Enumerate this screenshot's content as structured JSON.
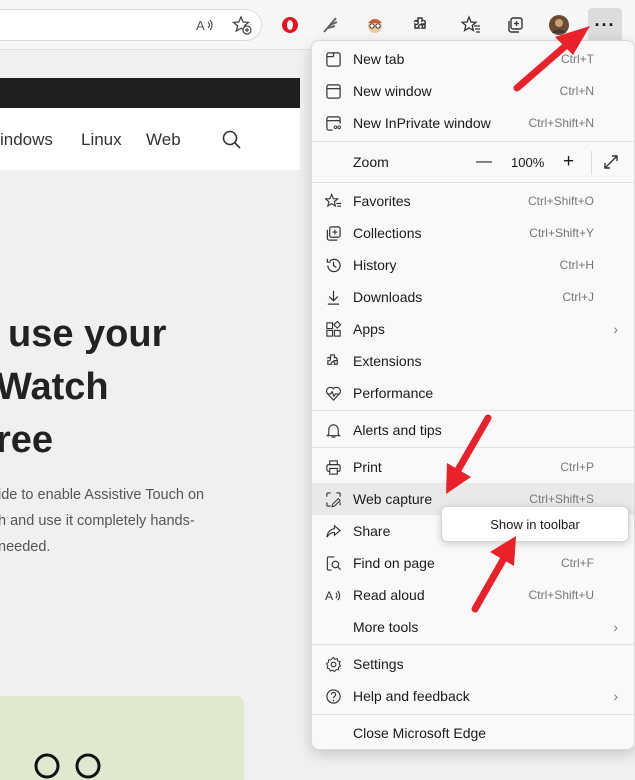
{
  "browser": {
    "more_button_label": "···",
    "toolbar_icons": [
      "read-aloud-icon",
      "add-favorite-icon",
      "opera-extension-icon",
      "feather-extension-icon",
      "face-extension-icon",
      "extensions-icon",
      "favorites-icon",
      "collections-icon",
      "profile-avatar-icon",
      "more-icon"
    ]
  },
  "page": {
    "nav": [
      "indows",
      "Linux",
      "Web"
    ],
    "headline": [
      "use your",
      "Watch",
      "ree"
    ],
    "body": [
      "ide to enable Assistive Touch on",
      "h and use it completely hands-",
      "needed."
    ]
  },
  "menu": {
    "items": [
      {
        "label": "New tab",
        "shortcut": "Ctrl+T",
        "icon": "new-tab-icon"
      },
      {
        "label": "New window",
        "shortcut": "Ctrl+N",
        "icon": "new-window-icon"
      },
      {
        "label": "New InPrivate window",
        "shortcut": "Ctrl+Shift+N",
        "icon": "inprivate-icon"
      },
      {
        "label": "Zoom",
        "icon": "zoom-icon"
      },
      {
        "label": "Favorites",
        "shortcut": "Ctrl+Shift+O",
        "icon": "favorites-icon"
      },
      {
        "label": "Collections",
        "shortcut": "Ctrl+Shift+Y",
        "icon": "collections-icon"
      },
      {
        "label": "History",
        "shortcut": "Ctrl+H",
        "icon": "history-icon"
      },
      {
        "label": "Downloads",
        "shortcut": "Ctrl+J",
        "icon": "download-icon"
      },
      {
        "label": "Apps",
        "icon": "apps-icon",
        "submenu": true
      },
      {
        "label": "Extensions",
        "icon": "extensions-icon"
      },
      {
        "label": "Performance",
        "icon": "performance-icon"
      },
      {
        "label": "Alerts and tips",
        "icon": "bell-icon"
      },
      {
        "label": "Print",
        "shortcut": "Ctrl+P",
        "icon": "print-icon"
      },
      {
        "label": "Web capture",
        "shortcut": "Ctrl+Shift+S",
        "icon": "web-capture-icon"
      },
      {
        "label": "Share",
        "icon": "share-icon"
      },
      {
        "label": "Find on page",
        "shortcut": "Ctrl+F",
        "icon": "find-icon"
      },
      {
        "label": "Read aloud",
        "shortcut": "Ctrl+Shift+U",
        "icon": "read-aloud-icon"
      },
      {
        "label": "More tools",
        "icon": "more-tools-icon",
        "submenu": true
      },
      {
        "label": "Settings",
        "icon": "gear-icon"
      },
      {
        "label": "Help and feedback",
        "icon": "help-icon",
        "submenu": true
      },
      {
        "label": "Close Microsoft Edge"
      }
    ],
    "zoom": {
      "minus": "—",
      "value": "100%",
      "plus": "+"
    },
    "chevron": "›"
  },
  "tooltip": {
    "label": "Show in toolbar"
  },
  "colors": {
    "arrow": "#e8212b",
    "menu_bg": "#f9f9f9",
    "page_bg": "#f0f0f0"
  }
}
